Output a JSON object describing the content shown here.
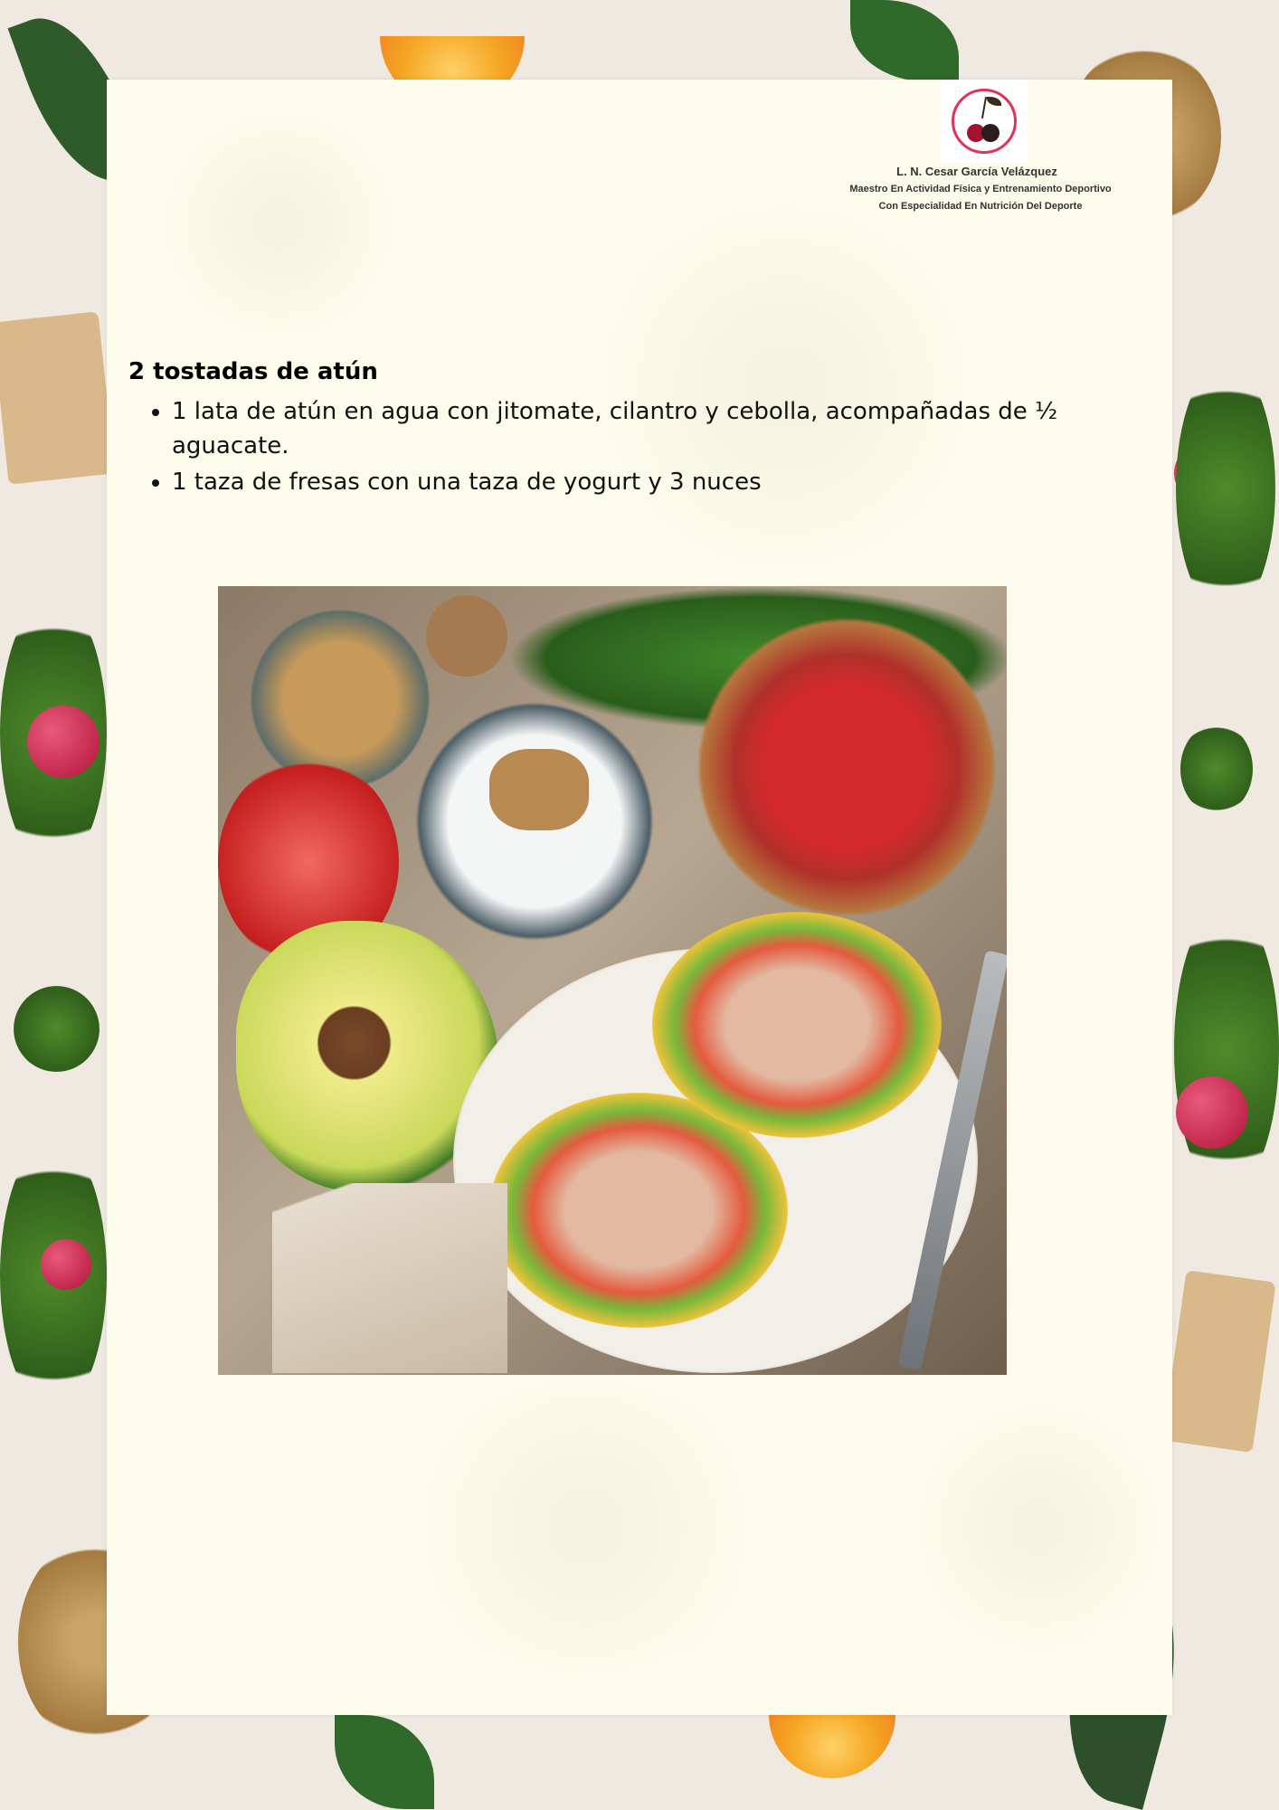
{
  "header": {
    "author_name": "L. N. Cesar García Velázquez",
    "credential_line_1": "Maestro En Actividad Física y Entrenamiento Deportivo",
    "credential_line_2": "Con Especialidad En Nutrición Del Deporte",
    "logo_icon": "cherry-logo-icon"
  },
  "recipe": {
    "title": "2 tostadas de atún",
    "items": [
      "1 lata de atún en agua con jitomate, cilantro y cebolla, acompañadas de ½ aguacate.",
      "1 taza de fresas con una taza de yogurt y 3 nuces"
    ]
  },
  "colors": {
    "page_background": "#efe9e2",
    "paper": "#fdfbeb",
    "logo_accent": "#e0325a"
  }
}
